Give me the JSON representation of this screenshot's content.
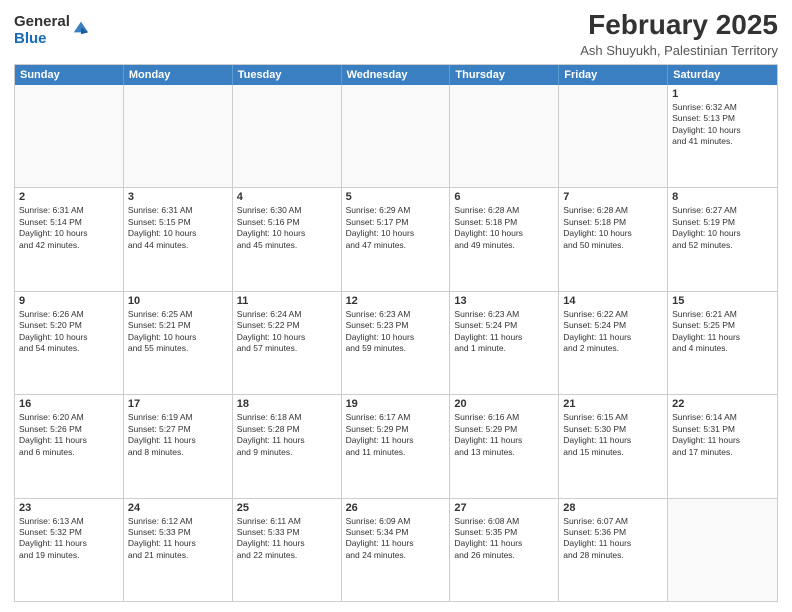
{
  "logo": {
    "general": "General",
    "blue": "Blue"
  },
  "title": "February 2025",
  "subtitle": "Ash Shuyukh, Palestinian Territory",
  "days": [
    "Sunday",
    "Monday",
    "Tuesday",
    "Wednesday",
    "Thursday",
    "Friday",
    "Saturday"
  ],
  "weeks": [
    [
      {
        "day": "",
        "info": ""
      },
      {
        "day": "",
        "info": ""
      },
      {
        "day": "",
        "info": ""
      },
      {
        "day": "",
        "info": ""
      },
      {
        "day": "",
        "info": ""
      },
      {
        "day": "",
        "info": ""
      },
      {
        "day": "1",
        "info": "Sunrise: 6:32 AM\nSunset: 5:13 PM\nDaylight: 10 hours\nand 41 minutes."
      }
    ],
    [
      {
        "day": "2",
        "info": "Sunrise: 6:31 AM\nSunset: 5:14 PM\nDaylight: 10 hours\nand 42 minutes."
      },
      {
        "day": "3",
        "info": "Sunrise: 6:31 AM\nSunset: 5:15 PM\nDaylight: 10 hours\nand 44 minutes."
      },
      {
        "day": "4",
        "info": "Sunrise: 6:30 AM\nSunset: 5:16 PM\nDaylight: 10 hours\nand 45 minutes."
      },
      {
        "day": "5",
        "info": "Sunrise: 6:29 AM\nSunset: 5:17 PM\nDaylight: 10 hours\nand 47 minutes."
      },
      {
        "day": "6",
        "info": "Sunrise: 6:28 AM\nSunset: 5:18 PM\nDaylight: 10 hours\nand 49 minutes."
      },
      {
        "day": "7",
        "info": "Sunrise: 6:28 AM\nSunset: 5:18 PM\nDaylight: 10 hours\nand 50 minutes."
      },
      {
        "day": "8",
        "info": "Sunrise: 6:27 AM\nSunset: 5:19 PM\nDaylight: 10 hours\nand 52 minutes."
      }
    ],
    [
      {
        "day": "9",
        "info": "Sunrise: 6:26 AM\nSunset: 5:20 PM\nDaylight: 10 hours\nand 54 minutes."
      },
      {
        "day": "10",
        "info": "Sunrise: 6:25 AM\nSunset: 5:21 PM\nDaylight: 10 hours\nand 55 minutes."
      },
      {
        "day": "11",
        "info": "Sunrise: 6:24 AM\nSunset: 5:22 PM\nDaylight: 10 hours\nand 57 minutes."
      },
      {
        "day": "12",
        "info": "Sunrise: 6:23 AM\nSunset: 5:23 PM\nDaylight: 10 hours\nand 59 minutes."
      },
      {
        "day": "13",
        "info": "Sunrise: 6:23 AM\nSunset: 5:24 PM\nDaylight: 11 hours\nand 1 minute."
      },
      {
        "day": "14",
        "info": "Sunrise: 6:22 AM\nSunset: 5:24 PM\nDaylight: 11 hours\nand 2 minutes."
      },
      {
        "day": "15",
        "info": "Sunrise: 6:21 AM\nSunset: 5:25 PM\nDaylight: 11 hours\nand 4 minutes."
      }
    ],
    [
      {
        "day": "16",
        "info": "Sunrise: 6:20 AM\nSunset: 5:26 PM\nDaylight: 11 hours\nand 6 minutes."
      },
      {
        "day": "17",
        "info": "Sunrise: 6:19 AM\nSunset: 5:27 PM\nDaylight: 11 hours\nand 8 minutes."
      },
      {
        "day": "18",
        "info": "Sunrise: 6:18 AM\nSunset: 5:28 PM\nDaylight: 11 hours\nand 9 minutes."
      },
      {
        "day": "19",
        "info": "Sunrise: 6:17 AM\nSunset: 5:29 PM\nDaylight: 11 hours\nand 11 minutes."
      },
      {
        "day": "20",
        "info": "Sunrise: 6:16 AM\nSunset: 5:29 PM\nDaylight: 11 hours\nand 13 minutes."
      },
      {
        "day": "21",
        "info": "Sunrise: 6:15 AM\nSunset: 5:30 PM\nDaylight: 11 hours\nand 15 minutes."
      },
      {
        "day": "22",
        "info": "Sunrise: 6:14 AM\nSunset: 5:31 PM\nDaylight: 11 hours\nand 17 minutes."
      }
    ],
    [
      {
        "day": "23",
        "info": "Sunrise: 6:13 AM\nSunset: 5:32 PM\nDaylight: 11 hours\nand 19 minutes."
      },
      {
        "day": "24",
        "info": "Sunrise: 6:12 AM\nSunset: 5:33 PM\nDaylight: 11 hours\nand 21 minutes."
      },
      {
        "day": "25",
        "info": "Sunrise: 6:11 AM\nSunset: 5:33 PM\nDaylight: 11 hours\nand 22 minutes."
      },
      {
        "day": "26",
        "info": "Sunrise: 6:09 AM\nSunset: 5:34 PM\nDaylight: 11 hours\nand 24 minutes."
      },
      {
        "day": "27",
        "info": "Sunrise: 6:08 AM\nSunset: 5:35 PM\nDaylight: 11 hours\nand 26 minutes."
      },
      {
        "day": "28",
        "info": "Sunrise: 6:07 AM\nSunset: 5:36 PM\nDaylight: 11 hours\nand 28 minutes."
      },
      {
        "day": "",
        "info": ""
      }
    ]
  ]
}
